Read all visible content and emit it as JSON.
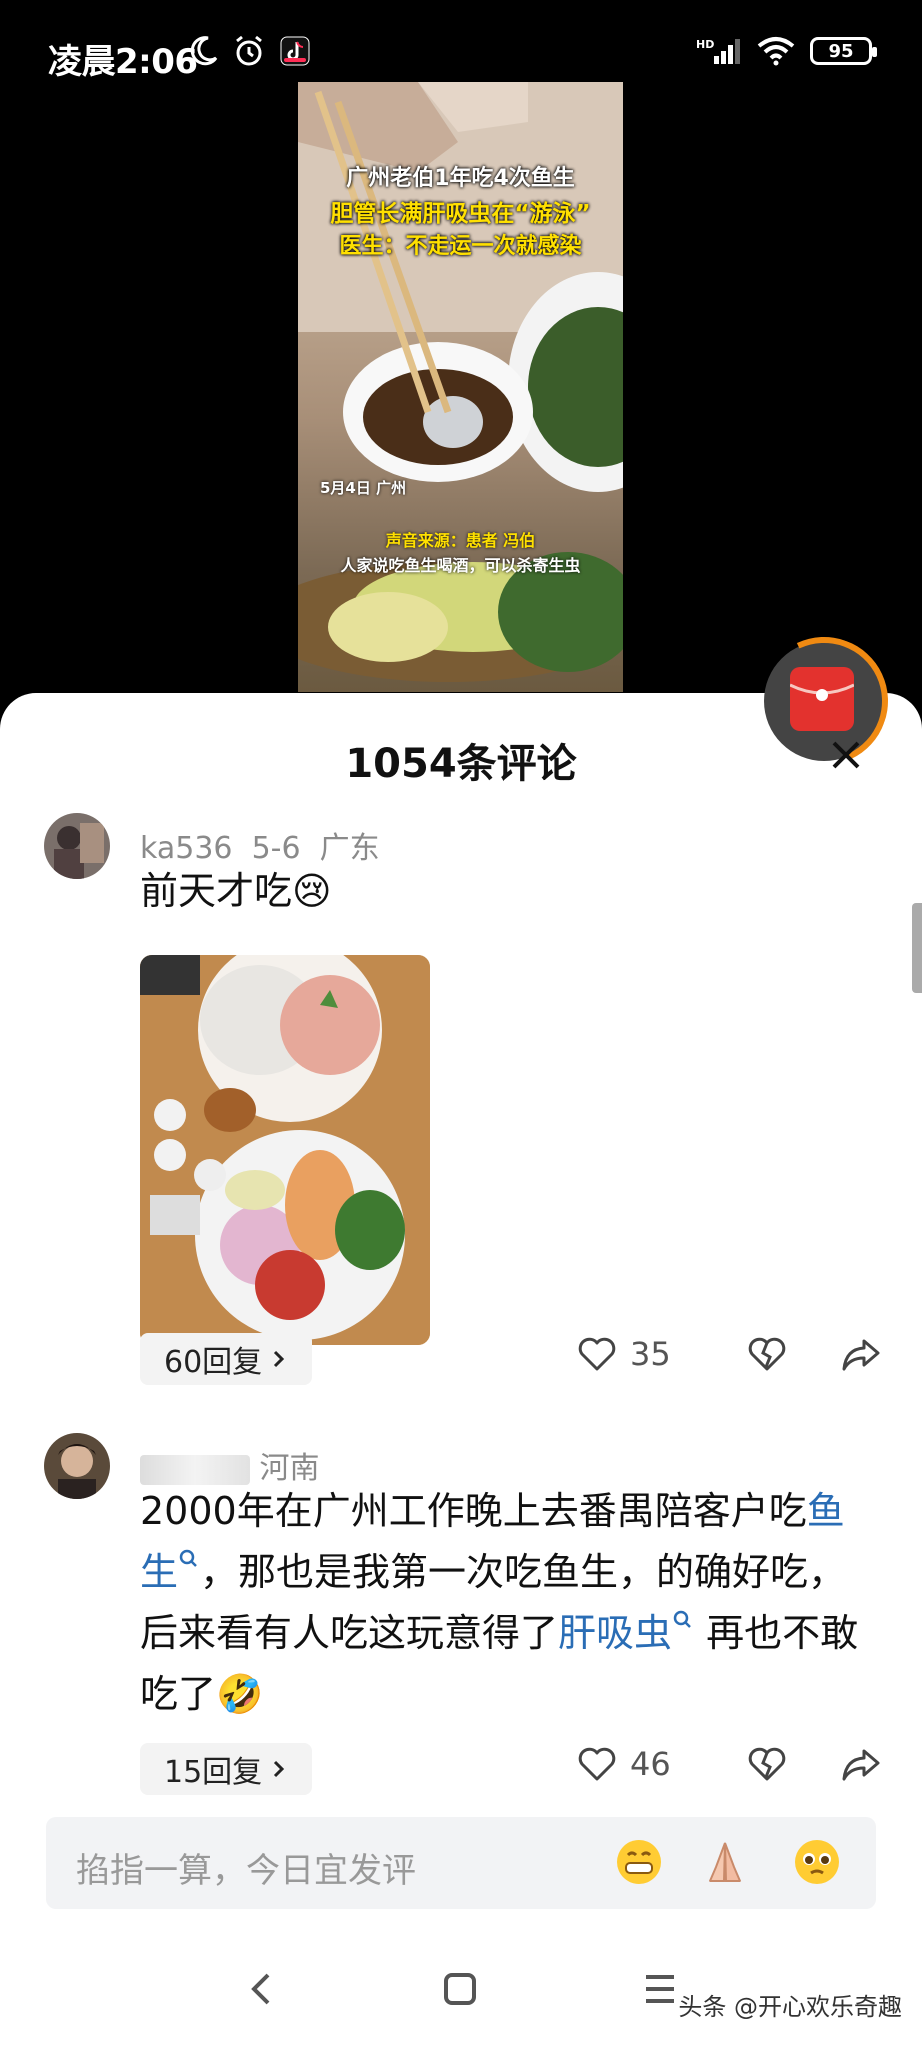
{
  "status_bar": {
    "time": "凌晨2:06",
    "battery": "95",
    "network": "HD"
  },
  "video": {
    "caption_line1": "广州老伯1年吃4次鱼生",
    "caption_line2": "胆管长满肝吸虫在“游泳”",
    "caption_line3": "医生：不走运一次就感染",
    "date_location": "5月4日 广州",
    "audio_source": "声音来源：患者 冯伯",
    "quote": "人家说吃鱼生喝酒，可以杀寄生虫"
  },
  "comments_panel": {
    "title": "1054条评论",
    "comments": [
      {
        "user": "ka536",
        "date": "5-6",
        "location": "广东",
        "text": "前天才吃",
        "emoji": "😢",
        "reply_label": "60回复",
        "likes": "35"
      },
      {
        "location": "河南",
        "text_part1": "2000年在广州工作晚上去番禺陪客户吃",
        "link1": "鱼生",
        "text_part2": "，那也是我第一次吃鱼生，的确好吃，后来看有人吃这玩意得了",
        "link2": "肝吸虫",
        "text_part3": "再也不敢吃了",
        "emoji": "🤣",
        "reply_label": "15回复",
        "likes": "46"
      }
    ]
  },
  "input": {
    "placeholder": "掐指一算，今日宜发评"
  },
  "watermark": "头条 @开心欢乐奇趣",
  "colors": {
    "link": "#2a6db5",
    "redpacket": "#e3322e",
    "ring": "#f08a12"
  }
}
